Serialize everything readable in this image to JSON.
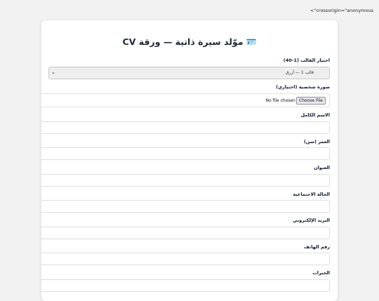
{
  "page": {
    "stray_text": "<\"crossorigin=\"anonymous"
  },
  "header": {
    "title": "موّلد سيرة ذاتية — ورقة CV",
    "title_icon": "id-card-icon",
    "title_icon_glyph": "🪪"
  },
  "form": {
    "template": {
      "label": "اختيار القالب (1-40)",
      "selected": "قالب 1 — أزرق"
    },
    "photo": {
      "label": "صورة شخصية (اختياري)",
      "button_label": "Choose File",
      "status": "No file chosen"
    },
    "full_name": {
      "label": "الاسم الكامل",
      "value": ""
    },
    "age": {
      "label": "العمر (سن)",
      "value": ""
    },
    "address": {
      "label": "العنوان",
      "value": ""
    },
    "marital_status": {
      "label": "الحالة الاجتماعية",
      "value": ""
    },
    "email": {
      "label": "البريد الإلكتروني",
      "value": ""
    },
    "phone": {
      "label": "رقم الهاتف",
      "value": ""
    },
    "experience": {
      "label": "الخبرات",
      "value": ""
    }
  },
  "colors": {
    "background": "#f2f2f2",
    "card": "#ffffff",
    "select_bg": "#eeeeee"
  }
}
